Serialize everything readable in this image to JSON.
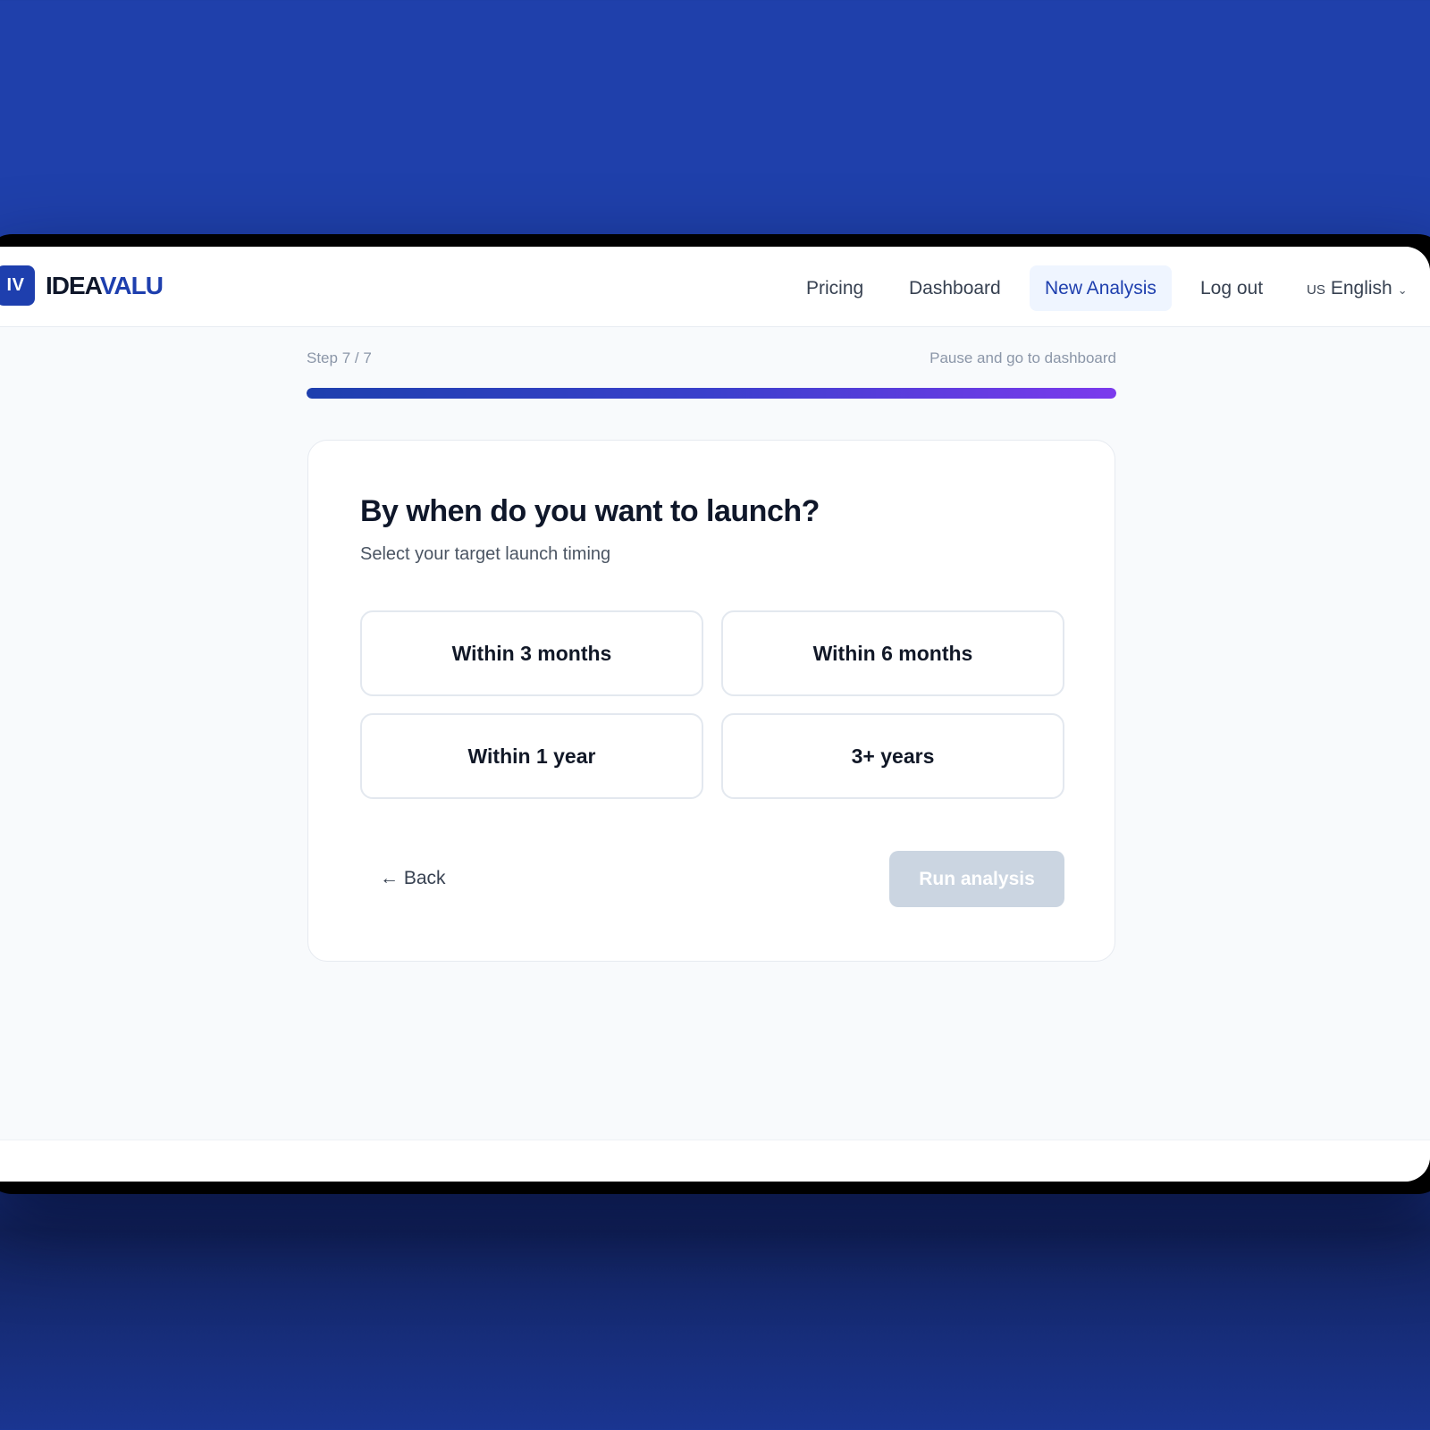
{
  "brand": {
    "logo_mark": "IV",
    "name_part1": "IDEA",
    "name_part2": "VALU"
  },
  "nav": {
    "items": [
      {
        "label": "Pricing",
        "active": false
      },
      {
        "label": "Dashboard",
        "active": false
      },
      {
        "label": "New Analysis",
        "active": true
      },
      {
        "label": "Log out",
        "active": false
      }
    ],
    "language": {
      "flag": "US",
      "label": "English",
      "icon": "chevron-down-icon"
    }
  },
  "progress": {
    "step_label": "Step 7 / 7",
    "pause_link": "Pause and go to dashboard",
    "percent": 100
  },
  "question": {
    "title": "By when do you want to launch?",
    "subtitle": "Select your target launch timing",
    "options": [
      "Within 3 months",
      "Within 6 months",
      "Within 1 year",
      "3+ years"
    ],
    "selected": null
  },
  "actions": {
    "back_label": "← Back",
    "run_label": "Run analysis",
    "run_enabled": false
  },
  "colors": {
    "brand_blue": "#1e3fae",
    "accent_purple": "#7c3aed",
    "disabled_button": "#cbd5e1",
    "background": "#1f40ab"
  }
}
